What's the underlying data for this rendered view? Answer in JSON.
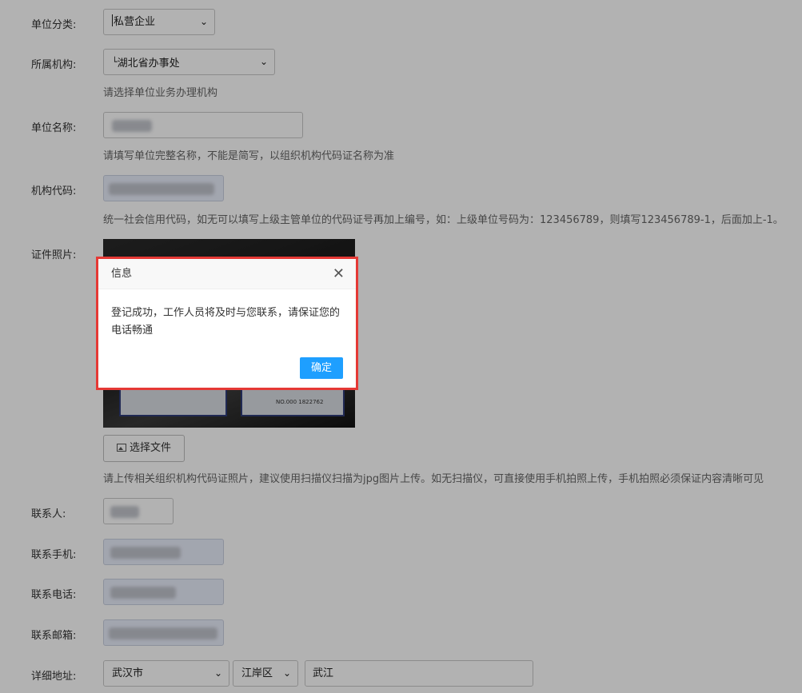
{
  "form": {
    "unit_type": {
      "label": "单位分类:",
      "value": "私营企业"
    },
    "org": {
      "label": "所属机构:",
      "value": "湖北省办事处",
      "hint": "请选择单位业务办理机构"
    },
    "unit_name": {
      "label": "单位名称:",
      "hint": "请填写单位完整名称，不能是简写，以组织机构代码证名称为准"
    },
    "org_code": {
      "label": "机构代码:",
      "hint": "统一社会信用代码，如无可以填写上级主管单位的代码证号再加上编号，如：上级单位号码为：123456789，则填写123456789-1，后面加上-1。"
    },
    "photo": {
      "label": "证件照片:",
      "cert_no": "NO.000 1822762",
      "upload_button": "选择文件",
      "hint": "请上传相关组织机构代码证照片，建议使用扫描仪扫描为jpg图片上传。如无扫描仪，可直接使用手机拍照上传，手机拍照必须保证内容清晰可见"
    },
    "contact": {
      "label": "联系人:"
    },
    "mobile": {
      "label": "联系手机:"
    },
    "phone": {
      "label": "联系电话:"
    },
    "email": {
      "label": "联系邮箱:"
    },
    "address": {
      "label": "详细地址:",
      "city": "武汉市",
      "district": "江岸区",
      "detail": "武江"
    }
  },
  "dialog": {
    "title": "信息",
    "message_line1": "登记成功，工作人员将及时与您联系，请保证您的",
    "message_line2": "电话畅通",
    "ok_label": "确定"
  },
  "icons": {
    "dropdown": "chevron-down-icon",
    "close": "close-icon",
    "upload": "image-icon"
  },
  "colors": {
    "dialog_border": "#e53935",
    "primary_button": "#1e9fff",
    "overlay": "rgba(0,0,0,0.3)"
  }
}
